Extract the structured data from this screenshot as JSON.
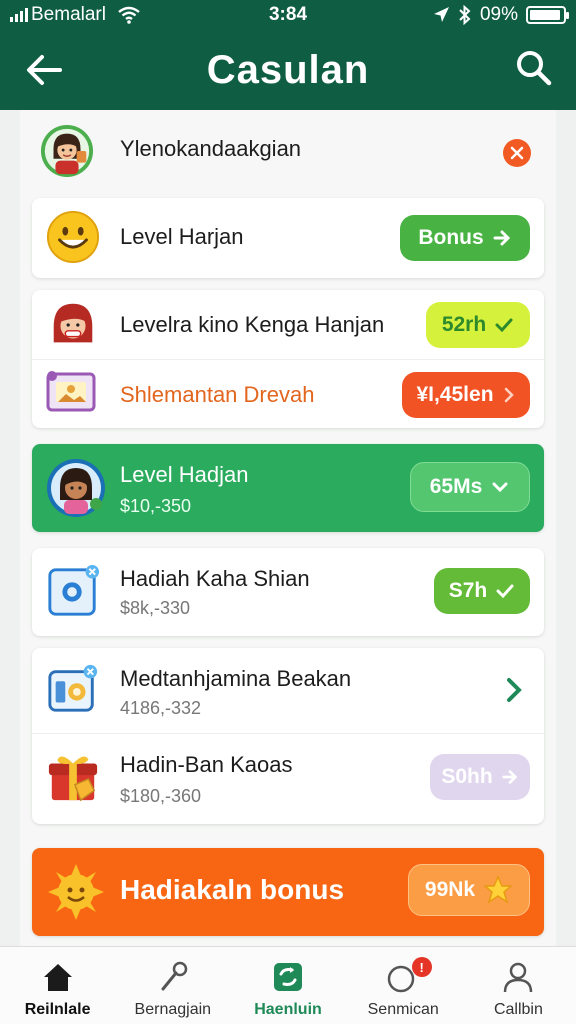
{
  "status_bar": {
    "carrier": "Bemalarl",
    "time": "3:84",
    "battery": "09%"
  },
  "header": {
    "title": "Casulan"
  },
  "rows": [
    {
      "title": "Ylenokandaakgian"
    },
    {
      "title": "Level Harjan",
      "button": "Bonus"
    },
    {
      "title": "Levelra kino Kenga Hanjan",
      "button": "52rh"
    },
    {
      "title": "Shlemantan Drevah",
      "button": "¥I,45len"
    },
    {
      "title": "Level Hadjan",
      "subtitle": "$10,-350",
      "button": "65Ms"
    },
    {
      "title": "Hadiah Kaha Shian",
      "subtitle": "$8k,-330",
      "button": "S7h"
    },
    {
      "title": "Medtanhjamina Beakan",
      "subtitle": "4186,-332"
    },
    {
      "title": "Hadin-Ban Kaoas",
      "subtitle": "$180,-360",
      "button": "S0hh"
    },
    {
      "title": "Hadiakaln bonus",
      "button": "99Nk"
    }
  ],
  "nav": {
    "items": [
      {
        "label": "Reilnlale"
      },
      {
        "label": "Bernagjain"
      },
      {
        "label": "Haenluin"
      },
      {
        "label": "Senmican"
      },
      {
        "label": "Callbin"
      }
    ],
    "active_index": 2
  },
  "colors": {
    "header_green": "#0f5e43",
    "card_green": "#2bab5e",
    "bonus_orange": "#f86614",
    "pill_green": "#48b243",
    "pill_lime": "#d6f13c",
    "pill_red": "#f25325",
    "pill_lavender": "#e0d6ee"
  }
}
